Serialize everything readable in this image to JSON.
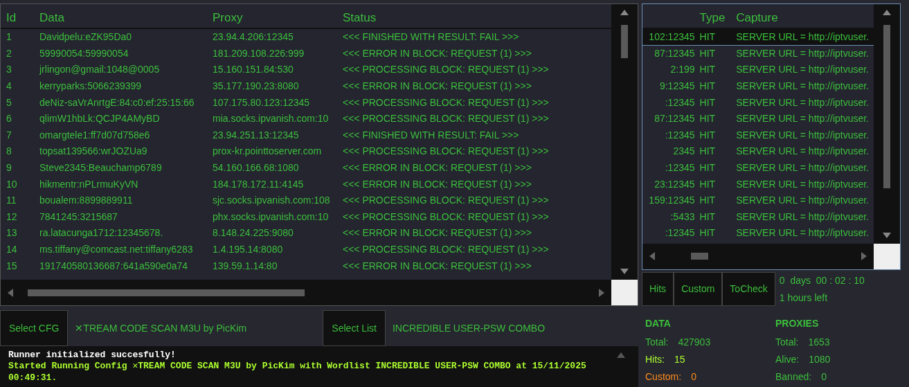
{
  "results_table": {
    "columns": [
      "Id",
      "Data",
      "Proxy",
      "Status"
    ],
    "rows": [
      {
        "id": "1",
        "data": "Davidpelu:eZK95Da0",
        "proxy": "23.94.4.206:12345",
        "status": "<<< FINISHED WITH RESULT: FAIL >>>"
      },
      {
        "id": "2",
        "data": "59990054:59990054",
        "proxy": "181.209.108.226:999",
        "status": "<<< ERROR IN BLOCK: REQUEST (1) >>>"
      },
      {
        "id": "3",
        "data": "jrlingon@gmail:1048@0005",
        "proxy": "15.160.151.84:530",
        "status": "<<< PROCESSING BLOCK: REQUEST (1) >>>"
      },
      {
        "id": "4",
        "data": "kerryparks:5066239399",
        "proxy": "35.177.190.23:8080",
        "status": "<<< ERROR IN BLOCK: REQUEST (1) >>>"
      },
      {
        "id": "5",
        "data": "deNiz-saVrAnrtgE:84:c0:ef:25:15:66",
        "proxy": "107.175.80.123:12345",
        "status": "<<< PROCESSING BLOCK: REQUEST (1) >>>"
      },
      {
        "id": "6",
        "data": "qlimW1hbLk:QCJP4AMyBD",
        "proxy": "mia.socks.ipvanish.com:10",
        "status": "<<< PROCESSING BLOCK: REQUEST (1) >>>"
      },
      {
        "id": "7",
        "data": "omargtele1:ff7d07d758e6",
        "proxy": "23.94.251.13:12345",
        "status": "<<< FINISHED WITH RESULT: FAIL >>>"
      },
      {
        "id": "8",
        "data": "topsat139566:wrJOZUa9",
        "proxy": "prox-kr.pointtoserver.com",
        "status": "<<< PROCESSING BLOCK: REQUEST (1) >>>"
      },
      {
        "id": "9",
        "data": "Steve2345:Beauchamp6789",
        "proxy": "54.160.166.68:1080",
        "status": "<<< ERROR IN BLOCK: REQUEST (1) >>>"
      },
      {
        "id": "10",
        "data": "hikmentr:nPLrmuKyVN",
        "proxy": "184.178.172.11:4145",
        "status": "<<< ERROR IN BLOCK: REQUEST (1) >>>"
      },
      {
        "id": "11",
        "data": "boualem:8899889911",
        "proxy": "sjc.socks.ipvanish.com:108",
        "status": "<<< PROCESSING BLOCK: REQUEST (1) >>>"
      },
      {
        "id": "12",
        "data": "7841245:3215687",
        "proxy": "phx.socks.ipvanish.com:10",
        "status": "<<< PROCESSING BLOCK: REQUEST (1) >>>"
      },
      {
        "id": "13",
        "data": "ra.latacunga1712:12345678.",
        "proxy": "8.148.24.225:9080",
        "status": "<<< ERROR IN BLOCK: REQUEST (1) >>>"
      },
      {
        "id": "14",
        "data": "ms.tiffany@comcast.net:tiffany6283",
        "proxy": "1.4.195.14:8080",
        "status": "<<< PROCESSING BLOCK: REQUEST (1) >>>"
      },
      {
        "id": "15",
        "data": "191740580136687:641a590e0a74",
        "proxy": "139.59.1.14:80",
        "status": "<<< ERROR IN BLOCK: REQUEST (1) >>>"
      }
    ]
  },
  "hits_table": {
    "columns": [
      "Type",
      "Capture"
    ],
    "rows": [
      {
        "column_1": "102:12345",
        "type": "HIT",
        "capture": "SERVER URL = http://iptvuser.",
        "selected": true
      },
      {
        "column_1": "87:12345",
        "type": "HIT",
        "capture": "SERVER URL = http://iptvuser.",
        "selected": false
      },
      {
        "column_1": "2:199",
        "type": "HIT",
        "capture": "SERVER URL = http://iptvuser.",
        "selected": false
      },
      {
        "column_1": "9:12345",
        "type": "HIT",
        "capture": "SERVER URL = http://iptvuser.",
        "selected": false
      },
      {
        "column_1": ":12345",
        "type": "HIT",
        "capture": "SERVER URL = http://iptvuser.",
        "selected": false
      },
      {
        "column_1": "87:12345",
        "type": "HIT",
        "capture": "SERVER URL = http://iptvuser.",
        "selected": false
      },
      {
        "column_1": ":12345",
        "type": "HIT",
        "capture": "SERVER URL = http://iptvuser.",
        "selected": false
      },
      {
        "column_1": "2345",
        "type": "HIT",
        "capture": "SERVER URL = http://iptvuser.",
        "selected": false
      },
      {
        "column_1": ":12345",
        "type": "HIT",
        "capture": "SERVER URL = http://iptvuser.",
        "selected": false
      },
      {
        "column_1": "23:12345",
        "type": "HIT",
        "capture": "SERVER URL = http://iptvuser.",
        "selected": false
      },
      {
        "column_1": "159:12345",
        "type": "HIT",
        "capture": "SERVER URL = http://iptvuser.",
        "selected": false
      },
      {
        "column_1": ":5433",
        "type": "HIT",
        "capture": "SERVER URL = http://iptvuser.",
        "selected": false
      },
      {
        "column_1": ":12345",
        "type": "HIT",
        "capture": "SERVER URL = http://iptvuser.",
        "selected": false
      }
    ]
  },
  "hit_buttons": [
    "Hits",
    "Custom",
    "ToCheck"
  ],
  "timer": {
    "elapsed": "0  days  00 : 02 : 10",
    "remaining": "1 hours left"
  },
  "config": {
    "button": "Select CFG",
    "name": "✕TREAM CODE SCAN M3U by PicKim"
  },
  "wordlist": {
    "button": "Select List",
    "name": "INCREDIBLE USER-PSW COMBO"
  },
  "log": [
    {
      "text": "Runner initialized succesfully!",
      "color": "#ffffff"
    },
    {
      "text": "Started Running Config ✕TREAM CODE SCAN M3U by PicKim with Wordlist INCREDIBLE USER-PSW COMBO at 15/11/2025 00:49:31.",
      "color": "#adff2f"
    }
  ],
  "stats": [
    {
      "title": "DATA",
      "items": [
        {
          "label": "Total:",
          "value": "427903",
          "color": "#3cbf3c"
        },
        {
          "label": "Hits:",
          "value": "15",
          "color": "#adff2f"
        },
        {
          "label": "Custom:",
          "value": "0",
          "color": "#ff8c1a"
        }
      ]
    },
    {
      "title": "PROXIES",
      "items": [
        {
          "label": "Total:",
          "value": "1653",
          "color": "#3cbf3c"
        },
        {
          "label": "Alive:",
          "value": "1080",
          "color": "#3cbf3c"
        },
        {
          "label": "Banned:",
          "value": "0",
          "color": "#3cbf3c"
        }
      ]
    }
  ]
}
